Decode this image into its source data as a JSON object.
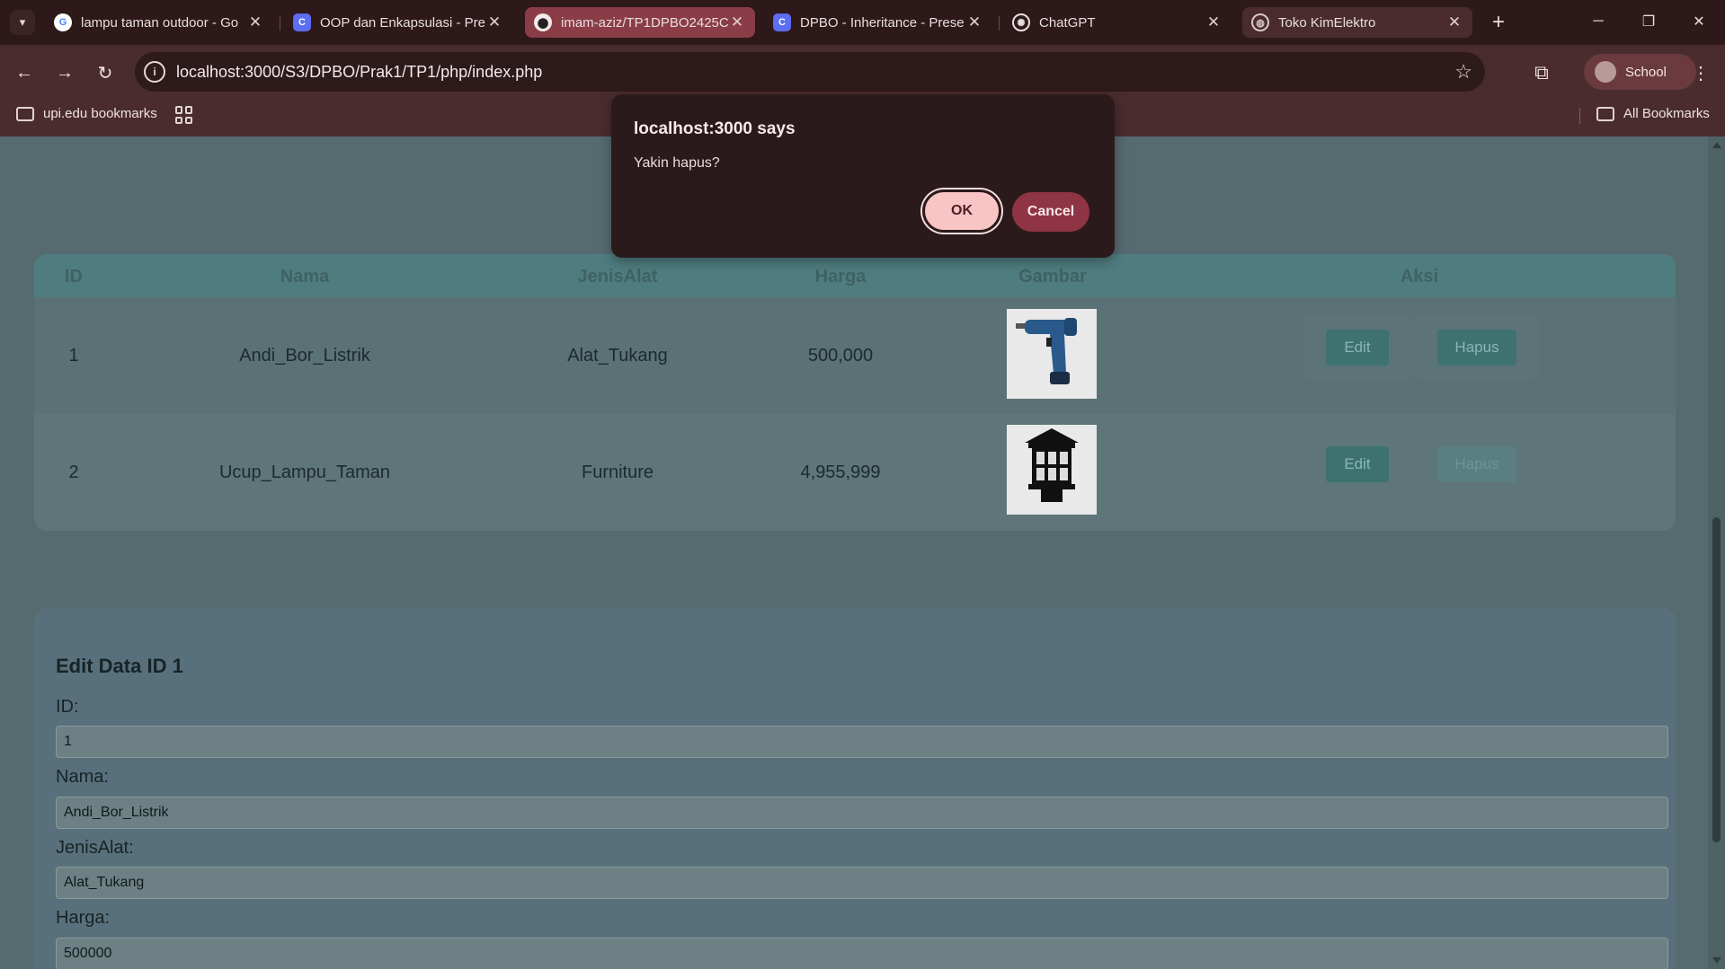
{
  "browser": {
    "tabs": [
      {
        "title": "lampu taman outdoor - Go",
        "favicon": "google-icon"
      },
      {
        "title": "OOP dan Enkapsulasi - Pre",
        "favicon": "slides-icon"
      },
      {
        "title": "imam-aziz/TP1DPBO2425C",
        "favicon": "github-icon"
      },
      {
        "title": "DPBO - Inheritance - Prese",
        "favicon": "slides-icon"
      },
      {
        "title": "ChatGPT",
        "favicon": "chatgpt-icon"
      },
      {
        "title": "Toko KimElektro",
        "favicon": "globe-icon"
      }
    ],
    "address": "localhost:3000/S3/DPBO/Prak1/TP1/php/index.php",
    "profile_label": "School",
    "bookmarks": {
      "left_label": "upi.edu bookmarks",
      "right_label": "All Bookmarks"
    },
    "colors": {
      "tabstrip": "#2d1919",
      "toolbar": "#4a2c2e",
      "accent": "#8a3d47"
    }
  },
  "dialog": {
    "title": "localhost:3000 says",
    "message": "Yakin hapus?",
    "ok_label": "OK",
    "cancel_label": "Cancel"
  },
  "table": {
    "headers": [
      "ID",
      "Nama",
      "JenisAlat",
      "Harga",
      "Gambar",
      "Aksi"
    ],
    "rows": [
      {
        "id": "1",
        "nama": "Andi_Bor_Listrik",
        "jenis": "Alat_Tukang",
        "harga": "500,000",
        "image": "drill-image"
      },
      {
        "id": "2",
        "nama": "Ucup_Lampu_Taman",
        "jenis": "Furniture",
        "harga": "4,955,999",
        "image": "garden-lamp-image"
      }
    ],
    "edit_label": "Edit",
    "hapus_label": "Hapus"
  },
  "form": {
    "title": "Edit Data ID 1",
    "fields": [
      {
        "label": "ID:",
        "value": "1"
      },
      {
        "label": "Nama:",
        "value": "Andi_Bor_Listrik"
      },
      {
        "label": "JenisAlat:",
        "value": "Alat_Tukang"
      },
      {
        "label": "Harga:",
        "value": "500000"
      }
    ]
  }
}
